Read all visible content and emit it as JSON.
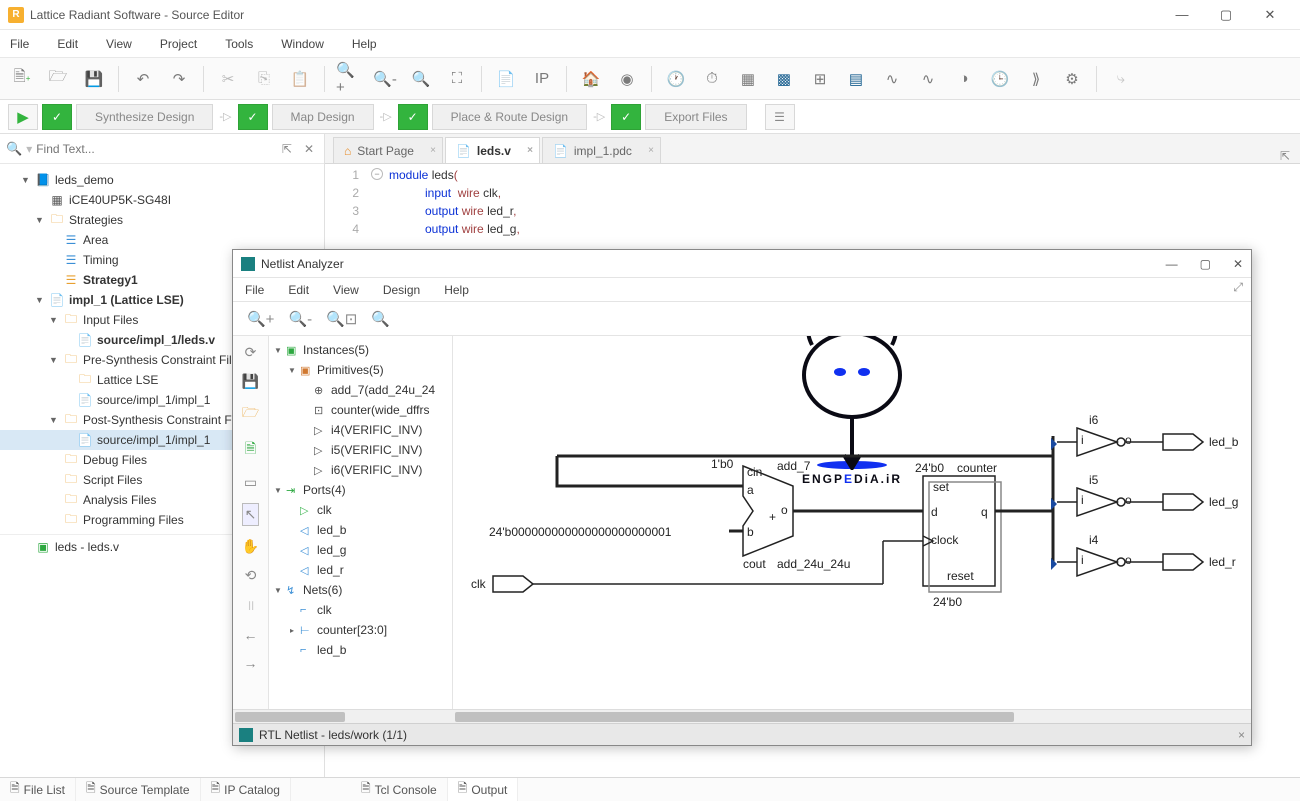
{
  "title": "Lattice Radiant Software - Source Editor",
  "menubar": [
    "File",
    "Edit",
    "View",
    "Project",
    "Tools",
    "Window",
    "Help"
  ],
  "flow_stages": {
    "synth": "Synthesize Design",
    "map": "Map Design",
    "par": "Place & Route Design",
    "export": "Export Files"
  },
  "search_placeholder": "Find Text...",
  "project_tree": {
    "root": "leds_demo",
    "device": "iCE40UP5K-SG48I",
    "strategies_label": "Strategies",
    "area": "Area",
    "timing": "Timing",
    "strategy1": "Strategy1",
    "impl": "impl_1 (Lattice LSE)",
    "input_files": "Input Files",
    "leds_v": "source/impl_1/leds.v",
    "presynth": "Pre-Synthesis Constraint Files",
    "lattice_lse": "Lattice LSE",
    "impl_src1": "source/impl_1/impl_1",
    "postsynth": "Post-Synthesis Constraint Files",
    "impl_src2": "source/impl_1/impl_1",
    "debug": "Debug Files",
    "script": "Script Files",
    "analysis": "Analysis Files",
    "prog": "Programming Files",
    "leds_node": "leds - leds.v"
  },
  "tabs": {
    "start": "Start Page",
    "leds": "leds.v",
    "pdc": "impl_1.pdc"
  },
  "code": {
    "l1_kw": "module",
    "l1_id": "leds",
    "l1_p": "(",
    "l2_kw": "input",
    "l2_ty": "wire",
    "l2_id": "clk",
    "l2_c": ",",
    "l3_kw": "output",
    "l3_ty": "wire",
    "l3_id": "led_r",
    "l3_c": ",",
    "l4_kw": "output",
    "l4_ty": "wire",
    "l4_id": "led_g",
    "l4_c": ",",
    "n1": "1",
    "n2": "2",
    "n3": "3",
    "n4": "4"
  },
  "netlist": {
    "title": "Netlist Analyzer",
    "menu": [
      "File",
      "Edit",
      "View",
      "Design",
      "Help"
    ],
    "instances": "Instances(5)",
    "primitives": "Primitives(5)",
    "add7": "add_7(add_24u_24",
    "counter": "counter(wide_dffrs",
    "i4": "i4(VERIFIC_INV)",
    "i5": "i5(VERIFIC_INV)",
    "i6": "i6(VERIFIC_INV)",
    "ports": "Ports(4)",
    "p_clk": "clk",
    "p_ledb": "led_b",
    "p_ledg": "led_g",
    "p_ledr": "led_r",
    "nets": "Nets(6)",
    "n_clk": "clk",
    "n_counter": "counter[23:0]",
    "n_ledb": "led_b",
    "status": "RTL Netlist - leds/work (1/1)",
    "sch": {
      "cin": "cin",
      "a": "a",
      "b": "b",
      "o": "o",
      "cout": "cout",
      "plus": "+",
      "add7": "add_7",
      "addname": "add_24u_24u",
      "onebit": "1'b0",
      "const24": "24'b000000000000000000000001",
      "set": "set",
      "d": "d",
      "clock": "clock",
      "q": "q",
      "reset": "reset",
      "cntlabel": "counter",
      "cnt24": "24'b0",
      "cnt24b": "24'b0",
      "i6": "i6",
      "i5": "i5",
      "i4": "i4",
      "i": "i",
      "io": "o",
      "ledb": "led_b",
      "ledg": "led_g",
      "ledr": "led_r",
      "clk": "clk"
    }
  },
  "footer": {
    "filelist": "File List",
    "srctmpl": "Source Template",
    "ipcat": "IP Catalog",
    "tcl": "Tcl Console",
    "output": "Output"
  },
  "watermark": "ENGPEDiA.iR"
}
